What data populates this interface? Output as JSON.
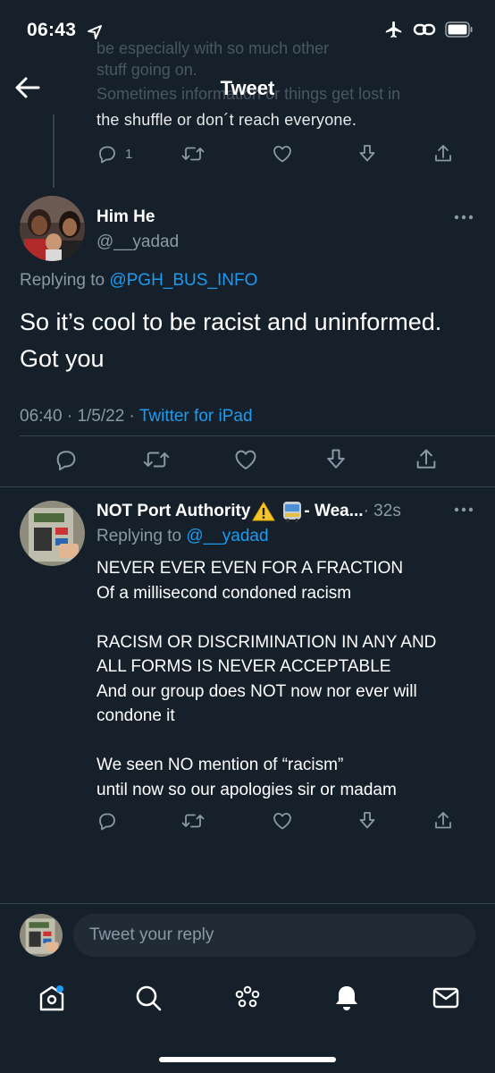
{
  "status_bar": {
    "time": "06:43"
  },
  "header": {
    "title": "Tweet"
  },
  "faded_text": {
    "line1": "be especially with so much other",
    "line2": "stuff going on.",
    "line3": "Sometimes information or things get lost in"
  },
  "prev_tweet": {
    "text_tail": "the shuffle or don´t reach everyone.",
    "reply_count": "1"
  },
  "main_tweet": {
    "name": "Him He",
    "handle": "@__yadad",
    "replying_prefix": "Replying to",
    "replying_to": "@PGH_BUS_INFO",
    "text": "So it’s cool to be racist and uninformed. Got you",
    "time": "06:40",
    "sep1": " · ",
    "date": "1/5/22",
    "sep2": " · ",
    "source": "Twitter for iPad"
  },
  "reply_tweet": {
    "name": "NOT Port Authority",
    "name_suffix": " - Wea...",
    "time_ago": " · 32s",
    "replying_prefix": "Replying to",
    "replying_to": "@__yadad",
    "lines": {
      "l1": "NEVER EVER EVEN FOR A FRACTION",
      "l2": "Of a millisecond condoned racism",
      "l3": "RACISM OR DISCRIMINATION IN ANY AND",
      "l4": "ALL FORMS IS NEVER ACCEPTABLE",
      "l5": "And our group does NOT now nor ever will",
      "l6": "condone it",
      "l7": "We seen NO mention of “racism”",
      "l8": "until now so our apologies sir or madam"
    }
  },
  "compose": {
    "placeholder": "Tweet your reply"
  },
  "icons": {
    "back": "arrow-left-icon",
    "reply": "reply-icon",
    "retweet": "retweet-icon",
    "like": "heart-icon",
    "bookmark": "download-icon",
    "share": "share-icon",
    "more": "more-icon"
  },
  "colors": {
    "background": "#15202b",
    "accent": "#1d9bf0",
    "muted": "#8b98a5",
    "divider": "#38444d"
  }
}
